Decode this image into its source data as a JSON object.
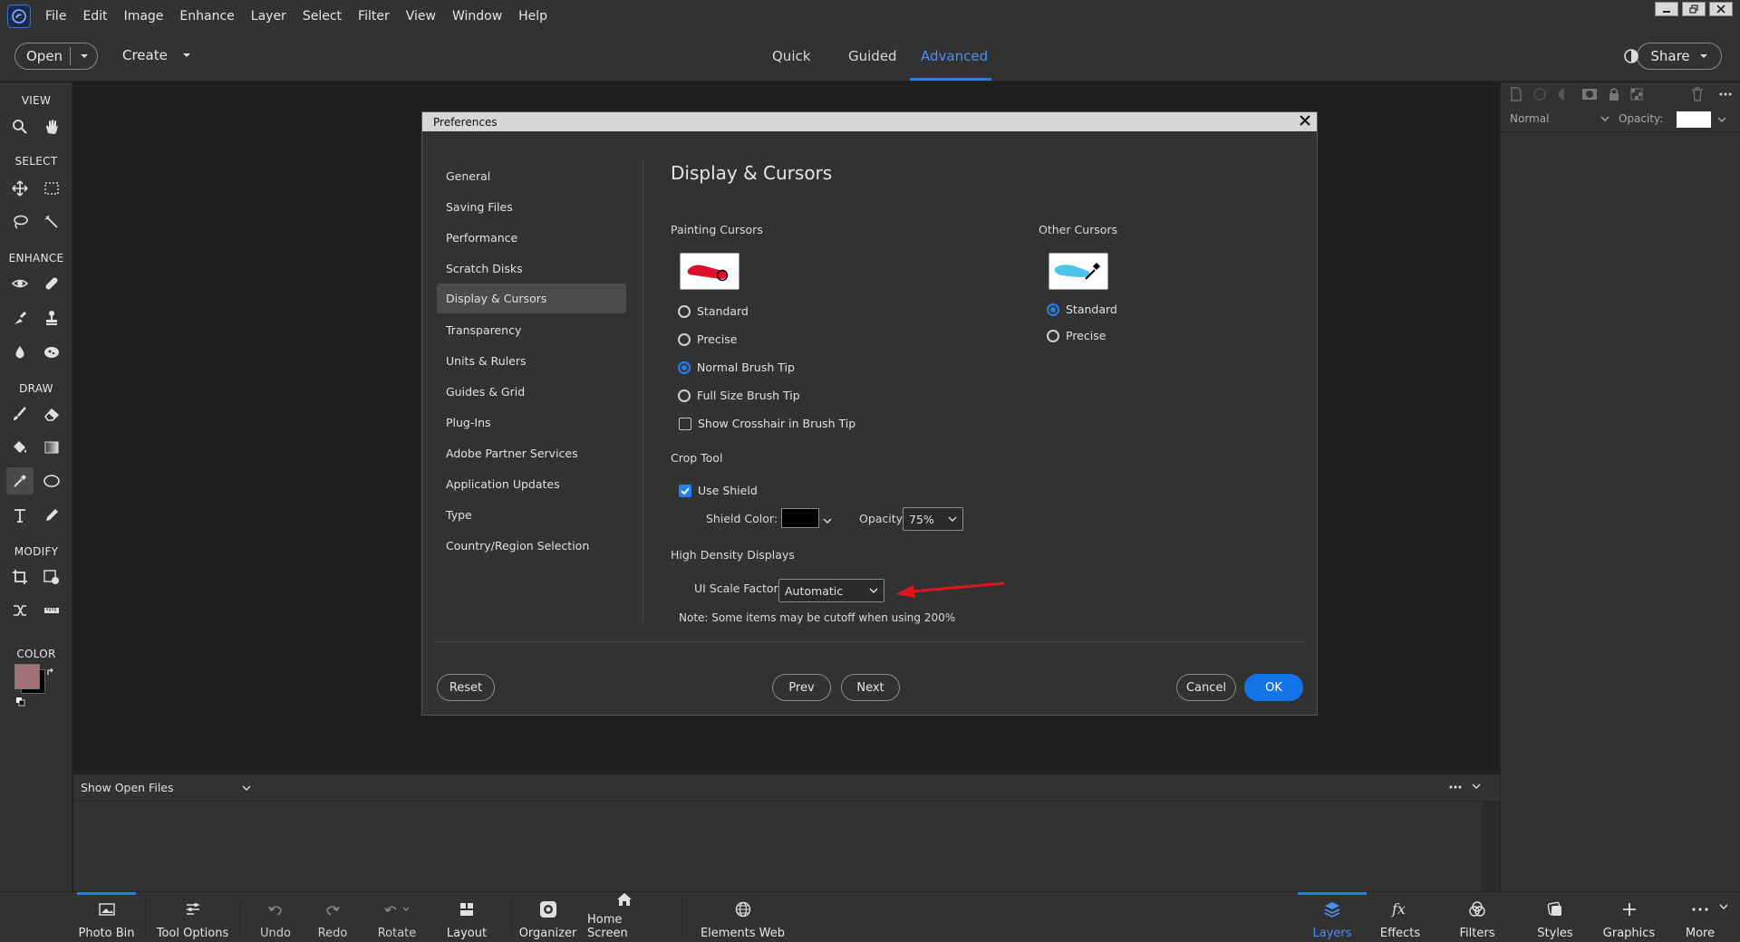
{
  "menubar": {
    "items": [
      "File",
      "Edit",
      "Image",
      "Enhance",
      "Layer",
      "Select",
      "Filter",
      "View",
      "Window",
      "Help"
    ]
  },
  "modebar": {
    "open_label": "Open",
    "create_label": "Create",
    "tabs": [
      "Quick",
      "Guided",
      "Advanced"
    ],
    "active_tab": "Advanced",
    "share_label": "Share"
  },
  "toolbar": {
    "sections": [
      "VIEW",
      "SELECT",
      "ENHANCE",
      "DRAW",
      "MODIFY",
      "COLOR"
    ],
    "foreground_color": "#a27173",
    "background_color": "#000000"
  },
  "right_panel": {
    "blend_mode": "Normal",
    "opacity_label": "Opacity:"
  },
  "photo_bin": {
    "dropdown_label": "Show Open Files"
  },
  "bottombar": {
    "items": [
      "Photo Bin",
      "Tool Options",
      "Undo",
      "Redo",
      "Rotate",
      "Layout",
      "Organizer",
      "Home Screen",
      "Elements Web"
    ],
    "right_items": [
      "Layers",
      "Effects",
      "Filters",
      "Styles",
      "Graphics",
      "More"
    ]
  },
  "dialog": {
    "title": "Preferences",
    "nav": [
      "General",
      "Saving Files",
      "Performance",
      "Scratch Disks",
      "Display & Cursors",
      "Transparency",
      "Units & Rulers",
      "Guides & Grid",
      "Plug-Ins",
      "Adobe Partner Services",
      "Application Updates",
      "Type",
      "Country/Region Selection"
    ],
    "selected_nav": "Display & Cursors",
    "heading": "Display & Cursors",
    "painting_cursors": {
      "label": "Painting Cursors",
      "options": [
        "Standard",
        "Precise",
        "Normal Brush Tip",
        "Full Size Brush Tip"
      ],
      "selected": "Normal Brush Tip",
      "crosshair_label": "Show Crosshair in Brush Tip",
      "crosshair_checked": false
    },
    "other_cursors": {
      "label": "Other Cursors",
      "options": [
        "Standard",
        "Precise"
      ],
      "selected": "Standard"
    },
    "crop_tool": {
      "label": "Crop Tool",
      "use_shield_label": "Use Shield",
      "use_shield_checked": true,
      "shield_color_label": "Shield Color:",
      "shield_color": "#000000",
      "opacity_label": "Opacity:",
      "opacity_value": "75%"
    },
    "high_density": {
      "label": "High Density Displays",
      "scale_label": "UI Scale Factor:",
      "scale_value": "Automatic",
      "note": "Note: Some items may be cutoff when using 200%"
    },
    "buttons": {
      "reset": "Reset",
      "prev": "Prev",
      "next": "Next",
      "cancel": "Cancel",
      "ok": "OK"
    }
  },
  "colors": {
    "accent": "#2680eb",
    "annotation_arrow": "#e0141c"
  }
}
